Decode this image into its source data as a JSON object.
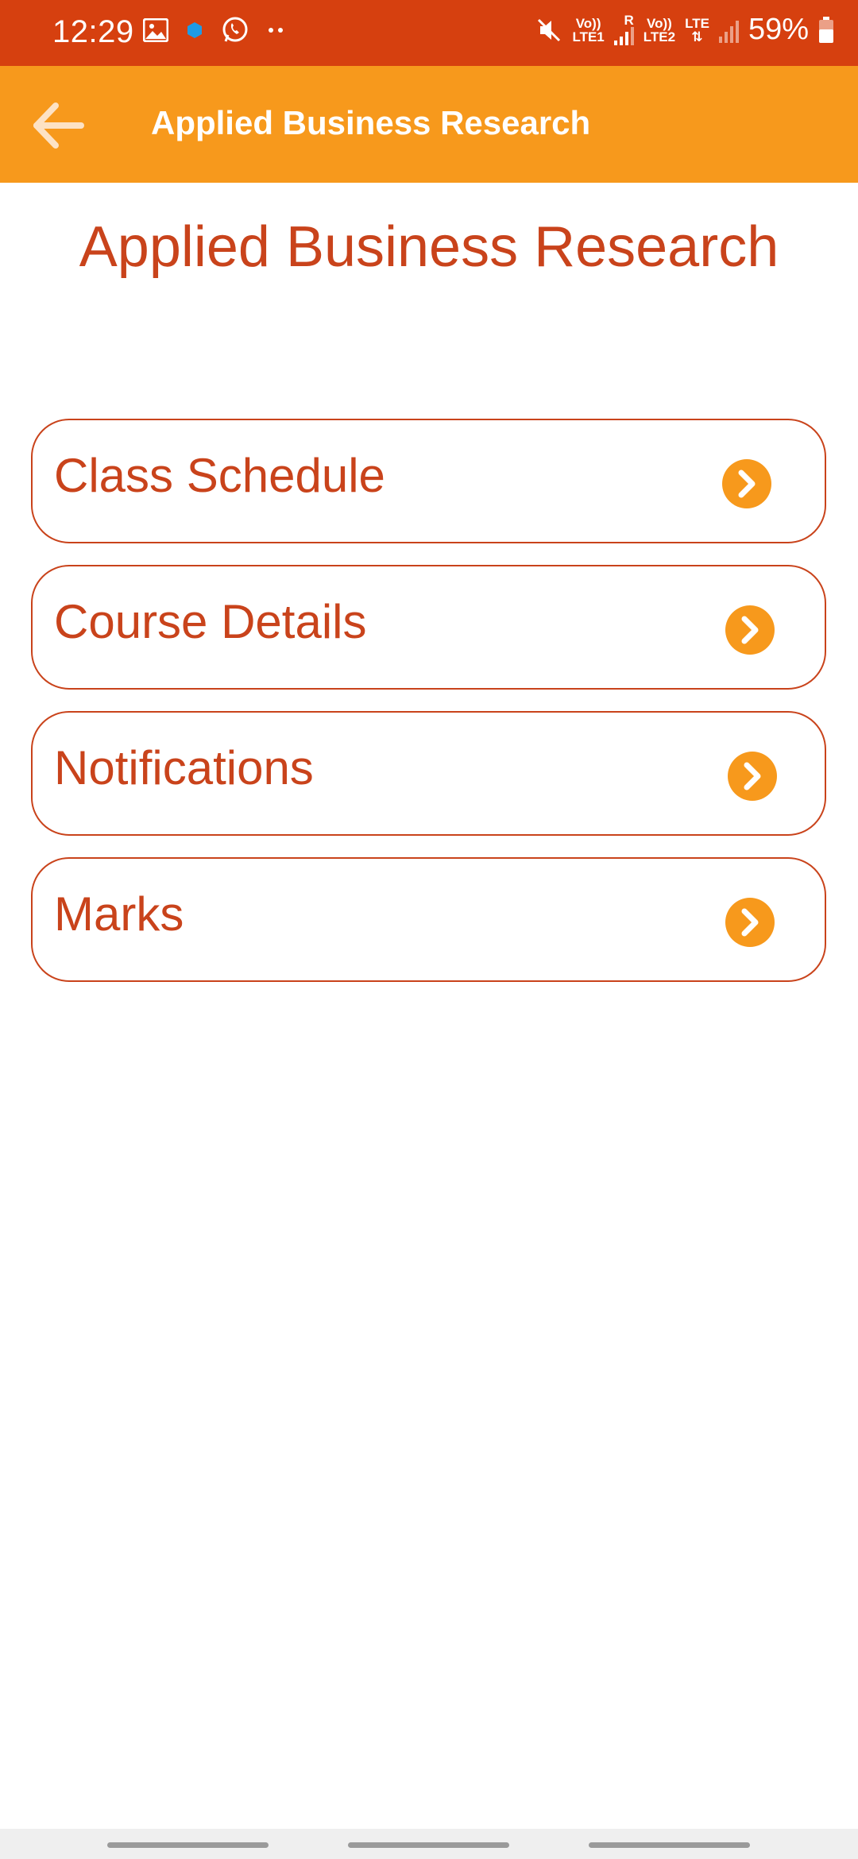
{
  "status_bar": {
    "time": "12:29",
    "battery_percent": "59%",
    "sim1_label_top": "Vo))",
    "sim1_label_bottom": "LTE1",
    "sim1_roaming": "R",
    "sim2_label_top": "Vo))",
    "sim2_label_bottom": "LTE2",
    "data_label": "LTE",
    "icons": [
      "gallery-icon",
      "notification-dot-icon",
      "whatsapp-icon",
      "more-dots-icon",
      "mute-icon",
      "signal-icon",
      "battery-icon"
    ]
  },
  "app_bar": {
    "title": "Applied Business Research",
    "back_icon": "arrow-left-icon",
    "background": "#f7991c"
  },
  "page": {
    "heading": "Applied Business Research"
  },
  "menu": {
    "items": [
      {
        "label": "Class Schedule",
        "icon": "chevron-right-circle-icon"
      },
      {
        "label": "Course Details",
        "icon": "chevron-right-circle-icon"
      },
      {
        "label": "Notifications",
        "icon": "chevron-right-circle-icon"
      },
      {
        "label": "Marks",
        "icon": "chevron-right-circle-icon"
      }
    ]
  },
  "colors": {
    "status_bar": "#d6400f",
    "accent_text": "#c9431b",
    "chevron_fill": "#f7991c"
  }
}
